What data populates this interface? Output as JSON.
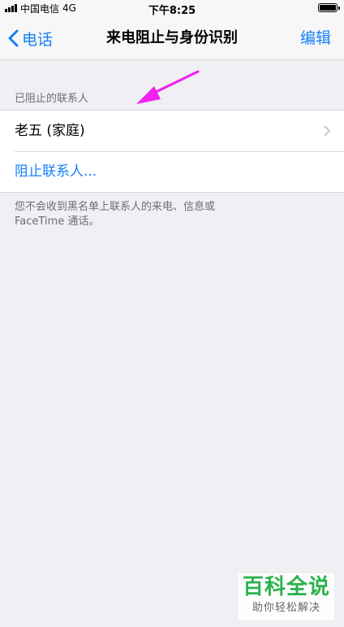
{
  "status_bar": {
    "carrier": "中国电信",
    "network": "4G",
    "time": "下午8:25",
    "battery_level": 1.0
  },
  "nav": {
    "back_label": "电话",
    "title": "来电阻止与身份识别",
    "edit_label": "编辑"
  },
  "section": {
    "header": "已阻止的联系人",
    "blocked_contacts": [
      {
        "name": "老五 (家庭)"
      }
    ],
    "add_action": "阻止联系人...",
    "footer": "您不会收到黑名单上联系人的来电、信息或\nFaceTime 通话。"
  },
  "watermark": {
    "main": "百科全说",
    "sub": "助你轻松解决"
  },
  "colors": {
    "accent": "#147efb",
    "background": "#efeff4",
    "annotation_arrow": "#f020f0",
    "watermark_green": "#2bb24c"
  }
}
